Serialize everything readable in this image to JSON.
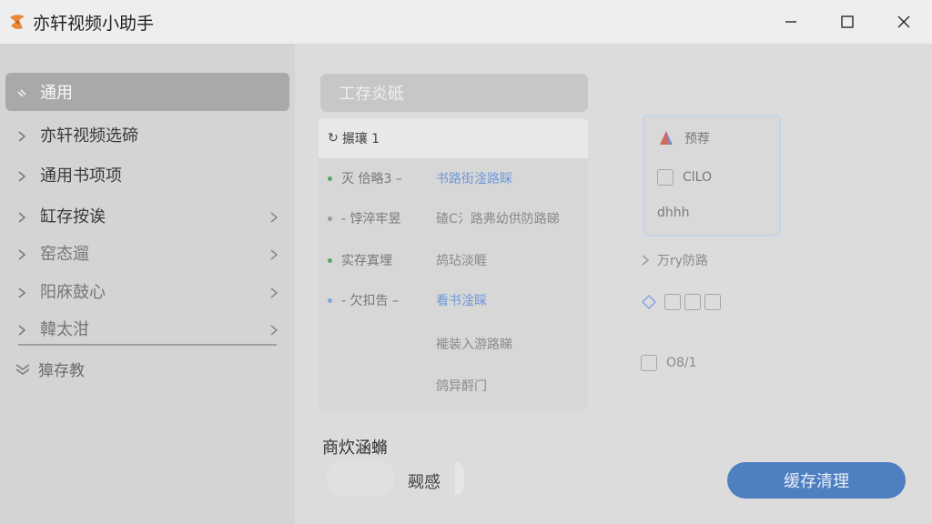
{
  "window": {
    "title": "亦轩视频小助手",
    "controls": [
      "minimize",
      "maximize",
      "close"
    ]
  },
  "sidebar": {
    "items": [
      {
        "label": "通用",
        "active": true,
        "has_submenu": false
      },
      {
        "label": "亦轩视频选碲",
        "active": false,
        "has_submenu": false
      },
      {
        "label": "通用书项项",
        "active": false,
        "has_submenu": false
      },
      {
        "label": "缸存按诶",
        "active": false,
        "has_submenu": true
      },
      {
        "label": "窑态遛",
        "active": false,
        "has_submenu": true
      },
      {
        "label": "阳庥鼓心",
        "active": false,
        "has_submenu": true
      },
      {
        "label": "韓太泔",
        "active": false,
        "has_submenu": true
      }
    ],
    "footer": {
      "label": "獐存教"
    }
  },
  "main": {
    "panel_header": "工存炎砥",
    "list": {
      "header": "搌瓖 1",
      "rows": [
        {
          "label": "灭 佮略3 –",
          "value": "书路街淦路睬",
          "dot": "#4ea86a",
          "link": true
        },
        {
          "label": "- 饽淬牢昱",
          "value": "碴C氵路弗幼供防路睇",
          "dot": "#9a9a9a",
          "link": false
        },
        {
          "label": "实存寘埋",
          "value": "鸪玷淡睚",
          "dot": "#4ea86a",
          "link": false
        },
        {
          "label": "- 欠扣告 –",
          "value": "看书淦睬",
          "dot": "#7fa5e0",
          "link": true
        },
        {
          "label": "",
          "value": "褦装入游路睇",
          "dot": "",
          "link": false
        },
        {
          "label": "",
          "value": "鸽异酹门",
          "dot": "",
          "link": false
        }
      ]
    },
    "card": {
      "title": "预荐",
      "field": "ClLO",
      "extra": "dhhh"
    },
    "fx": [
      {
        "label": "万ry防路",
        "icon": "chevron-icon"
      },
      {
        "label": "",
        "icon": "diamond-icon",
        "keys": [
          "",
          "",
          ""
        ]
      },
      {
        "label": "O8/1",
        "icon": "checkbox-icon"
      }
    ],
    "section_title": "商炊涵䗛",
    "toggle": {
      "label": "觋感",
      "on": false
    },
    "primary_button": "缓存清理"
  },
  "colors": {
    "accent": "#4e7fc0",
    "active_item": "#a9a9a9",
    "status_green": "#4ea86a"
  }
}
